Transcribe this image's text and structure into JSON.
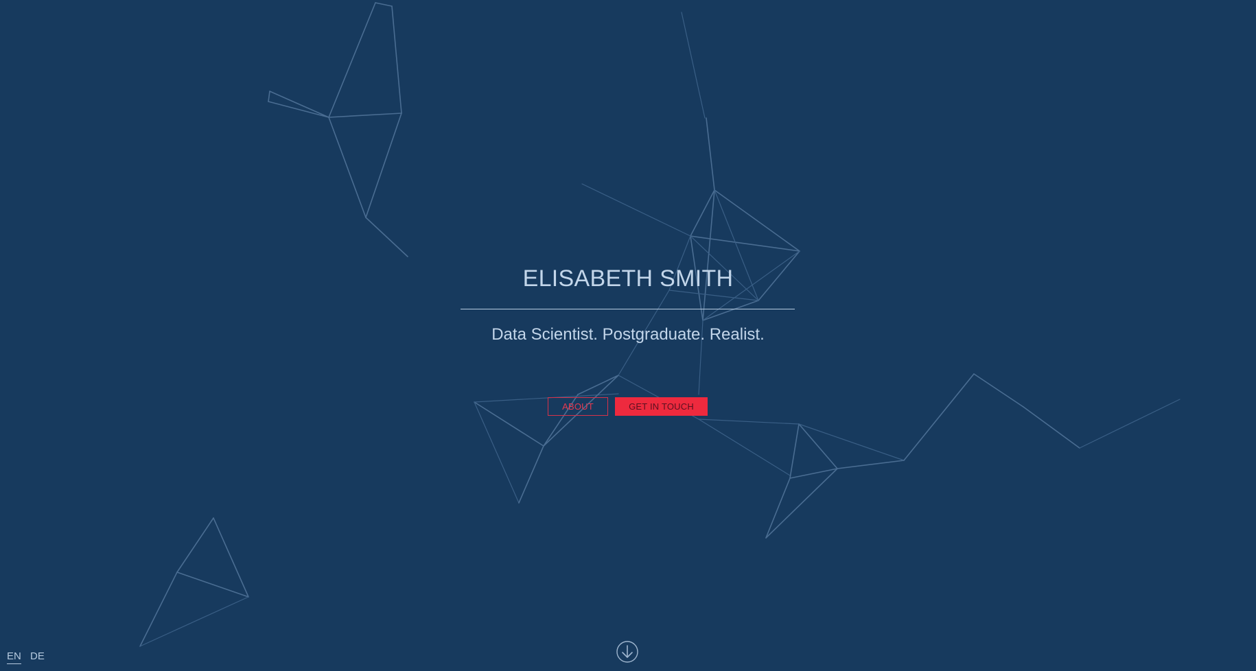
{
  "hero": {
    "name": "ELISABETH SMITH",
    "tagline": "Data Scientist. Postgraduate. Realist."
  },
  "actions": {
    "about_label": "ABOUT",
    "contact_label": "GET IN TOUCH"
  },
  "language": {
    "options": [
      "EN",
      "DE"
    ],
    "selected": "EN"
  },
  "icons": {
    "scroll": "arrow-down-circle-icon",
    "background": "particle-network"
  },
  "colors": {
    "background": "#173a5e",
    "text": "#c3d6ea",
    "accent": "#ee2a3e",
    "network_lines": "#4a6d92"
  }
}
